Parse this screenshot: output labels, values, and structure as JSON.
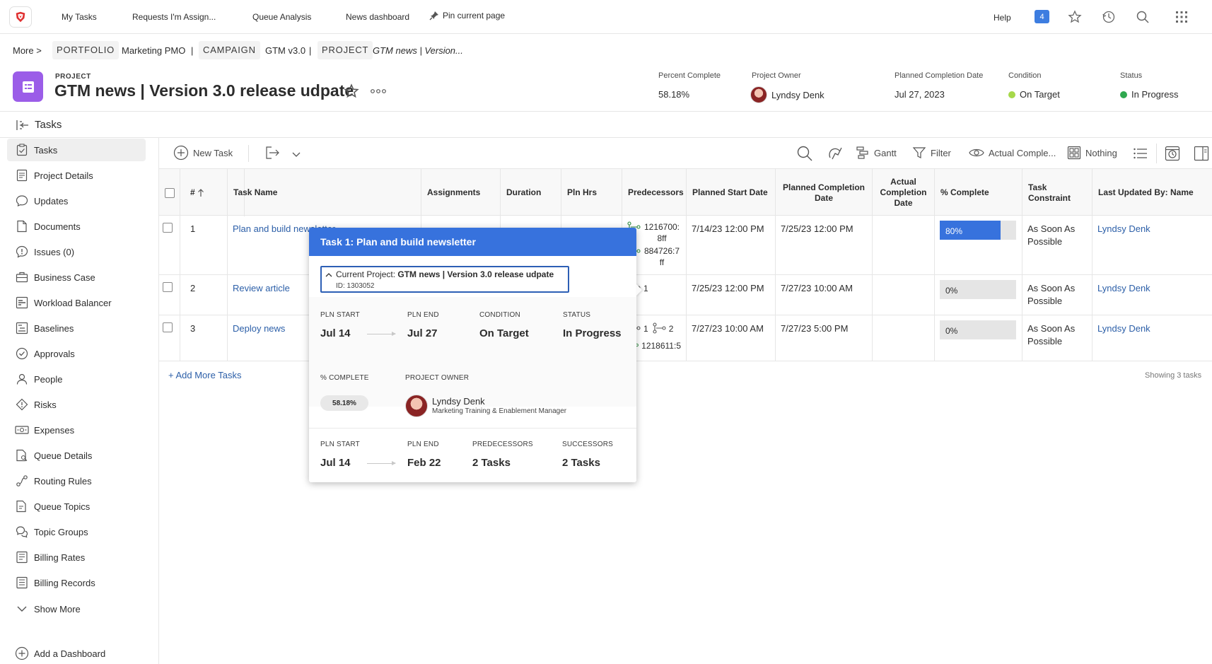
{
  "topnav": {
    "links": [
      "My Tasks",
      "Requests I'm Assign...",
      "Queue Analysis",
      "News dashboard"
    ],
    "pin": "Pin current page",
    "help": "Help",
    "notif_count": "4"
  },
  "breadcrumb": {
    "more": "More",
    "sep": ">",
    "portfolio_tag": "PORTFOLIO",
    "portfolio": "Marketing PMO",
    "campaign_tag": "CAMPAIGN",
    "campaign": "GTM v3.0",
    "project_tag": "PROJECT",
    "project": "GTM news | Version..."
  },
  "project": {
    "type": "PROJECT",
    "title": "GTM news | Version 3.0 release udpate",
    "percent_complete_label": "Percent Complete",
    "percent_complete": "58.18%",
    "owner_label": "Project Owner",
    "owner": "Lyndsy Denk",
    "planned_completion_label": "Planned Completion Date",
    "planned_completion": "Jul 27, 2023",
    "condition_label": "Condition",
    "condition": "On Target",
    "status_label": "Status",
    "status": "In Progress",
    "colors": {
      "accent": "#3772dd",
      "project_icon": "#9b5de8",
      "on_target": "#a6d84a",
      "in_progress": "#2fa84f"
    }
  },
  "tasks_title": "Tasks",
  "sidebar": {
    "items": [
      {
        "label": "Tasks",
        "icon": "tasks-icon"
      },
      {
        "label": "Project Details",
        "icon": "details-icon"
      },
      {
        "label": "Updates",
        "icon": "chat-icon"
      },
      {
        "label": "Documents",
        "icon": "document-icon"
      },
      {
        "label": "Issues (0)",
        "icon": "issue-icon"
      },
      {
        "label": "Business Case",
        "icon": "briefcase-icon"
      },
      {
        "label": "Workload Balancer",
        "icon": "workload-icon"
      },
      {
        "label": "Baselines",
        "icon": "baseline-icon"
      },
      {
        "label": "Approvals",
        "icon": "check-circle-icon"
      },
      {
        "label": "People",
        "icon": "person-icon"
      },
      {
        "label": "Risks",
        "icon": "risk-icon"
      },
      {
        "label": "Expenses",
        "icon": "money-icon"
      },
      {
        "label": "Queue Details",
        "icon": "queue-icon"
      },
      {
        "label": "Routing Rules",
        "icon": "routing-icon"
      },
      {
        "label": "Queue Topics",
        "icon": "topics-icon"
      },
      {
        "label": "Topic Groups",
        "icon": "topic-groups-icon"
      },
      {
        "label": "Billing Rates",
        "icon": "billing-icon"
      },
      {
        "label": "Billing Records",
        "icon": "records-icon"
      }
    ],
    "show_more": "Show More",
    "add_dashboard": "Add a Dashboard"
  },
  "toolbar": {
    "new_task": "New Task",
    "gantt": "Gantt",
    "filter": "Filter",
    "view": "Actual Comple...",
    "group": "Nothing"
  },
  "grid": {
    "headers": {
      "num": "#",
      "task_name": "Task Name",
      "assignments": "Assignments",
      "duration": "Duration",
      "pln_hrs": "Pln Hrs",
      "predecessors": "Predecessors",
      "planned_start": "Planned Start Date",
      "planned_completion": "Planned Completion Date",
      "actual_completion": "Actual Completion Date",
      "pct_complete": "% Complete",
      "constraint": "Task Constraint",
      "last_updated": "Last Updated By: Name"
    },
    "rows": [
      {
        "num": "1",
        "name": "Plan and build newsletter",
        "pred1": "1216700:8ff",
        "pred2": "884726:7ff",
        "start": "7/14/23 12:00 PM",
        "end": "7/25/23 12:00 PM",
        "pct_label": "80%",
        "pct": 0.8,
        "constraint": "As Soon As Possible",
        "updated": "Lyndsy Denk"
      },
      {
        "num": "2",
        "name": "Review article",
        "pred1": "1",
        "start": "7/25/23 12:00 PM",
        "end": "7/27/23 10:00 AM",
        "pct_label": "0%",
        "pct": 0,
        "constraint": "As Soon As Possible",
        "updated": "Lyndsy Denk"
      },
      {
        "num": "3",
        "name": "Deploy news",
        "pred1": "1",
        "pred1b": "2",
        "pred2": "1218611:5",
        "start": "7/27/23 10:00 AM",
        "end": "7/27/23 5:00 PM",
        "pct_label": "0%",
        "pct": 0,
        "constraint": "As Soon As Possible",
        "updated": "Lyndsy Denk"
      }
    ],
    "add_more": "+ Add More Tasks",
    "showing": "Showing 3 tasks"
  },
  "popup": {
    "title": "Task 1: Plan and build newsletter",
    "current_label": "Current Project:",
    "current_name": "GTM news | Version 3.0 release udpate",
    "id": "ID: 1303052",
    "pln_start_label": "PLN START",
    "pln_start": "Jul 14",
    "pln_end_label": "PLN END",
    "pln_end": "Jul 27",
    "condition_label": "CONDITION",
    "condition": "On Target",
    "status_label": "STATUS",
    "status": "In Progress",
    "pct_label": "% COMPLETE",
    "pct": "58.18%",
    "owner_label": "PROJECT OWNER",
    "owner": "Lyndsy Denk",
    "owner_title": "Marketing Training & Enablement Manager",
    "pln_start2": "Jul 14",
    "pln_end2": "Feb 22",
    "predecessors_label": "PREDECESSORS",
    "predecessors": "2 Tasks",
    "successors_label": "SUCCESSORS",
    "successors": "2 Tasks"
  }
}
